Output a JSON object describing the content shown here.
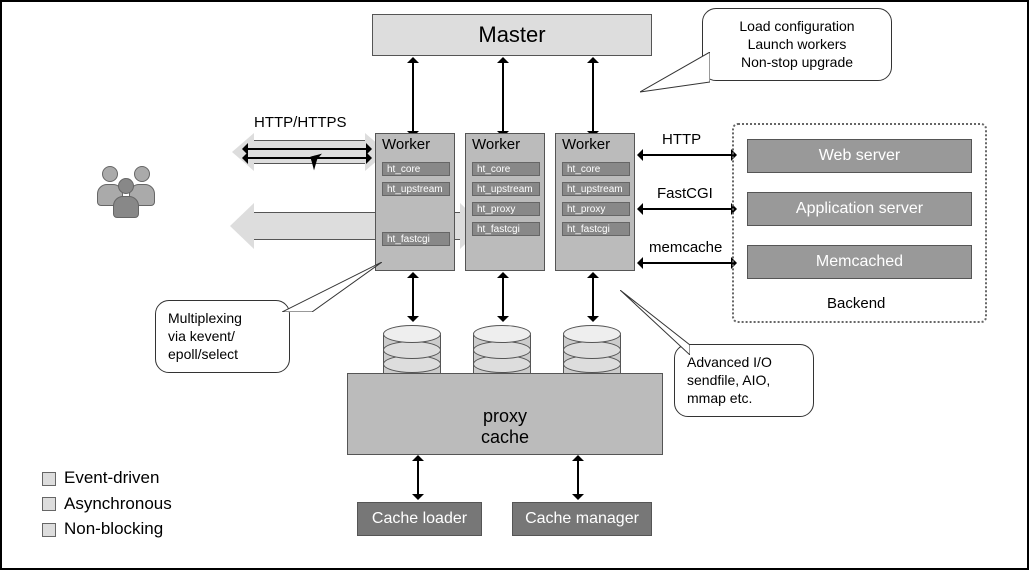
{
  "master": "Master",
  "master_callout": "Load configuration\nLaunch workers\nNon-stop upgrade",
  "http_https": "HTTP/HTTPS",
  "workers": [
    {
      "title": "Worker",
      "mods": [
        "ht_core",
        "ht_upstream",
        "",
        "ht_fastcgi"
      ]
    },
    {
      "title": "Worker",
      "mods": [
        "ht_core",
        "ht_upstream",
        "ht_proxy",
        "ht_fastcgi"
      ]
    },
    {
      "title": "Worker",
      "mods": [
        "ht_core",
        "ht_upstream",
        "ht_proxy",
        "ht_fastcgi"
      ]
    }
  ],
  "mux_callout": "Multiplexing\nvia kevent/\nepoll/select",
  "io_callout": "Advanced I/O\nsendfile, AIO,\nmmap etc.",
  "proto_http": "HTTP",
  "proto_fastcgi": "FastCGI",
  "proto_memcache": "memcache",
  "backend": {
    "label": "Backend",
    "items": [
      "Web server",
      "Application server",
      "Memcached"
    ]
  },
  "proxy_cache": "proxy\ncache",
  "cache_loader": "Cache loader",
  "cache_manager": "Cache manager",
  "legend": [
    "Event-driven",
    "Asynchronous",
    "Non-blocking"
  ]
}
